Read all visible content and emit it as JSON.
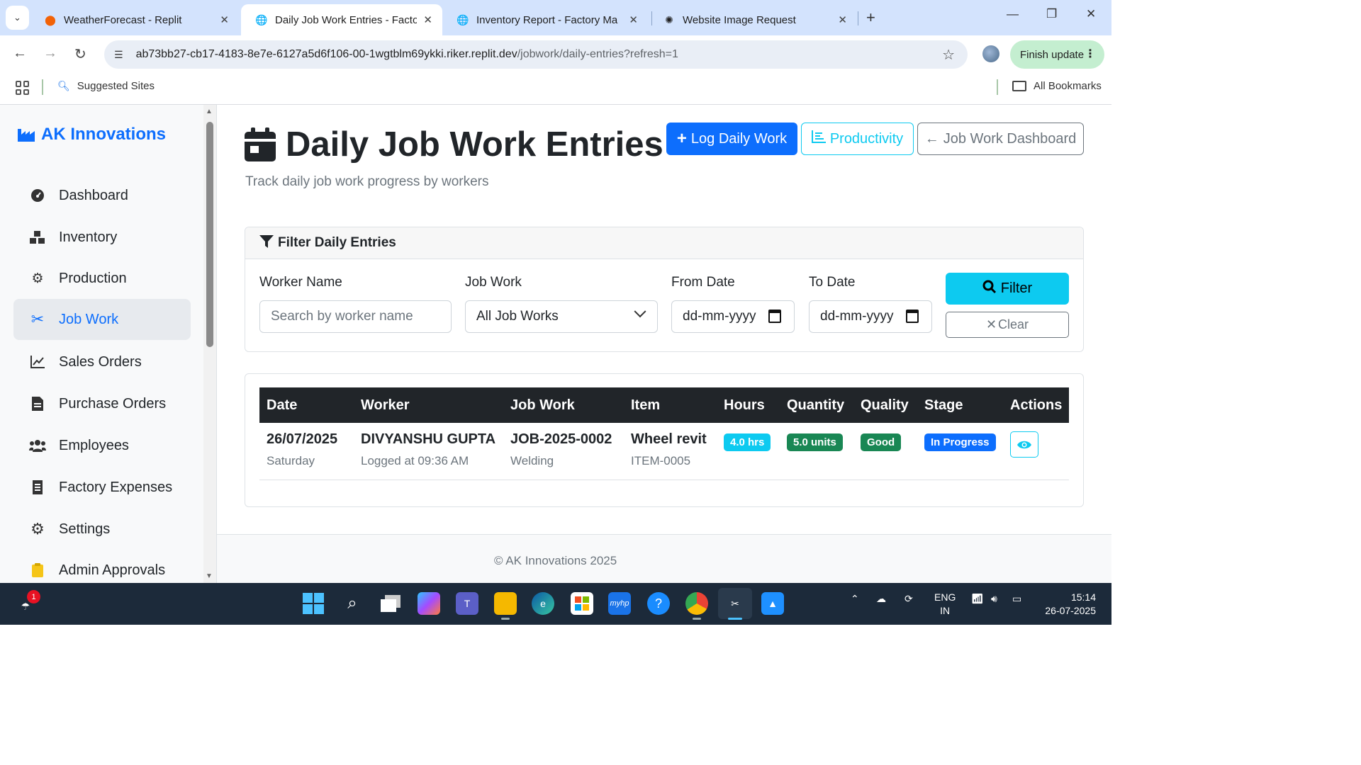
{
  "browser": {
    "tabs": [
      {
        "title": "WeatherForecast - Replit",
        "favicon": "replit-icon"
      },
      {
        "title": "Daily Job Work Entries - Factory",
        "favicon": "globe-icon",
        "active": true
      },
      {
        "title": "Inventory Report - Factory Man",
        "favicon": "globe-icon"
      },
      {
        "title": "Website Image Request",
        "favicon": "chatgpt-icon"
      }
    ],
    "url_main": "ab73bb27-cb17-4183-8e7e-6127a5d6f106-00-1wgtblm69ykki.riker.replit.dev",
    "url_path": "/jobwork/daily-entries?refresh=1",
    "finish_update": "Finish update",
    "bookmarks": {
      "suggested": "Suggested Sites",
      "all": "All Bookmarks"
    }
  },
  "sidebar": {
    "brand": "AK Innovations",
    "items": [
      {
        "label": "Dashboard",
        "icon": "gauge-icon"
      },
      {
        "label": "Inventory",
        "icon": "boxes-icon"
      },
      {
        "label": "Production",
        "icon": "cogs-icon"
      },
      {
        "label": "Job Work",
        "icon": "tools-icon",
        "active": true
      },
      {
        "label": "Sales Orders",
        "icon": "chart-line-icon"
      },
      {
        "label": "Purchase Orders",
        "icon": "file-invoice-icon"
      },
      {
        "label": "Employees",
        "icon": "users-icon"
      },
      {
        "label": "Factory Expenses",
        "icon": "receipt-icon"
      },
      {
        "label": "Settings",
        "icon": "gear-icon"
      },
      {
        "label": "Admin Approvals",
        "icon": "clipboard-check-icon"
      }
    ]
  },
  "page": {
    "title": "Daily Job Work Entries",
    "subtitle": "Track daily job work progress by workers",
    "buttons": {
      "log": "Log Daily Work",
      "productivity": "Productivity",
      "dashboard": "Job Work Dashboard"
    }
  },
  "filter": {
    "header": "Filter Daily Entries",
    "worker_label": "Worker Name",
    "worker_placeholder": "Search by worker name",
    "jobwork_label": "Job Work",
    "jobwork_value": "All Job Works",
    "from_label": "From Date",
    "from_placeholder": "dd-mm-yyyy",
    "to_label": "To Date",
    "to_placeholder": "dd-mm-yyyy",
    "filter_btn": "Filter",
    "clear_btn": "Clear"
  },
  "table": {
    "headers": [
      "Date",
      "Worker",
      "Job Work",
      "Item",
      "Hours",
      "Quantity",
      "Quality",
      "Stage",
      "Actions"
    ],
    "rows": [
      {
        "date": "26/07/2025",
        "day": "Saturday",
        "worker": "DIVYANSHU GUPTA",
        "logged": "Logged at 09:36 AM",
        "job": "JOB-2025-0002",
        "job_type": "Welding",
        "item": "Wheel revit",
        "item_code": "ITEM-0005",
        "hours": "4.0 hrs",
        "quantity": "5.0 units",
        "quality": "Good",
        "stage": "In Progress"
      }
    ]
  },
  "footer": "© AK Innovations 2025",
  "taskbar": {
    "lang": "ENG",
    "region": "IN",
    "time": "15:14",
    "date": "26-07-2025",
    "notification_count": "1"
  },
  "colors": {
    "primary": "#0d6efd",
    "info": "#0dcaf0",
    "success": "#198754",
    "dark": "#212529"
  }
}
